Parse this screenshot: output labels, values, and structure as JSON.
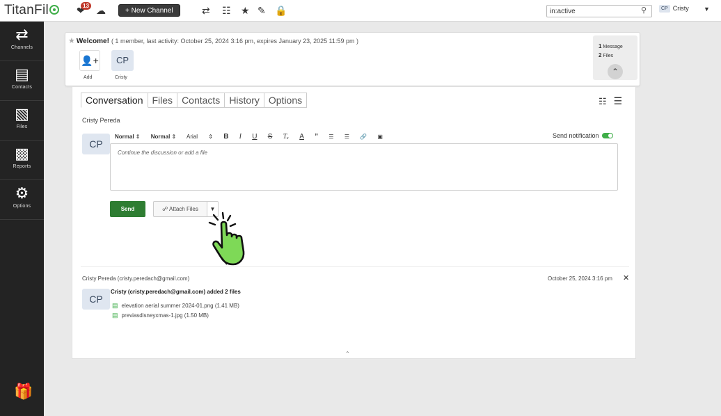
{
  "topbar": {
    "logo": "TitanFil",
    "notif_count": "13",
    "new_channel_label": "+ New Channel",
    "search_value": "in:active",
    "user_initials": "CP",
    "user_name": "Cristy"
  },
  "sidebar": {
    "items": [
      {
        "label": "Channels",
        "icon": "channels-icon"
      },
      {
        "label": "Contacts",
        "icon": "contacts-icon"
      },
      {
        "label": "Files",
        "icon": "files-icon"
      },
      {
        "label": "Reports",
        "icon": "reports-icon"
      },
      {
        "label": "Options",
        "icon": "options-icon"
      }
    ]
  },
  "header": {
    "welcome_title": "Welcome!",
    "welcome_meta": "( 1 member, last activity: October 25, 2024 3:16 pm, expires January 23, 2025 11:59 pm )",
    "add_label": "Add",
    "member_initials": "CP",
    "member_name": "Cristy",
    "messages_count": "1",
    "messages_label": "Message",
    "files_count": "2",
    "files_label": "Files"
  },
  "tabs": [
    "Conversation",
    "Files",
    "Contacts",
    "History",
    "Options"
  ],
  "composer": {
    "author": "Cristy Pereda",
    "avatar_initials": "CP",
    "toolbar": {
      "style1": "Normal",
      "style2": "Normal",
      "font": "Arial"
    },
    "send_notification_label": "Send notification",
    "placeholder": "Continue the discussion or add a file",
    "send_label": "Send",
    "attach_label": "Attach Files"
  },
  "message": {
    "author": "Cristy Pereda (cristy.peredach@gmail.com)",
    "date": "October 25, 2024 3:16 pm",
    "avatar_initials": "CP",
    "summary": "Cristy (cristy.peredach@gmail.com) added 2 files",
    "files": [
      "elevation aerial summer 2024-01.png (1.41 MB)",
      "previasdisneyxmas-1.jpg (1.50 MB)"
    ]
  },
  "colors": {
    "accent_green": "#3fae49",
    "send_green": "#2e7d32",
    "sidebar_bg": "#232323",
    "hand_green": "#7ed957"
  }
}
